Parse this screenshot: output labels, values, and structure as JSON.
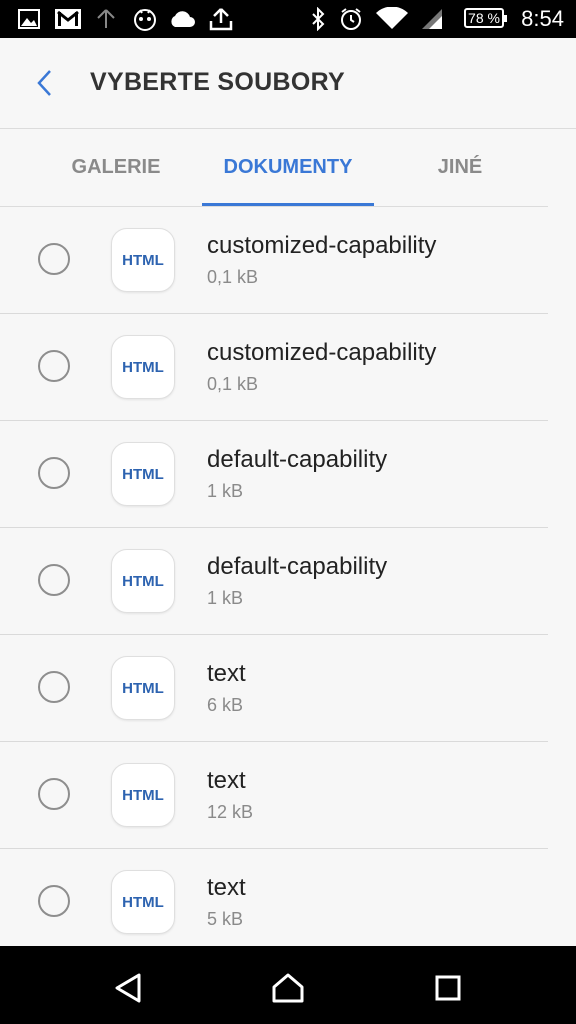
{
  "status_bar": {
    "time": "8:54",
    "battery": "78 %",
    "icons": [
      "gallery-icon",
      "gmail-icon",
      "upload-arrow-icon",
      "robot-icon",
      "cloud-icon",
      "share-upload-icon",
      "bluetooth-icon",
      "alarm-icon",
      "wifi-icon",
      "signal-icon",
      "battery-icon"
    ]
  },
  "header": {
    "title": "VYBERTE SOUBORY",
    "back_icon": "back-arrow-icon"
  },
  "tabs": [
    {
      "label": "GALERIE",
      "active": false
    },
    {
      "label": "DOKUMENTY",
      "active": true
    },
    {
      "label": "JINÉ",
      "active": false
    }
  ],
  "files": [
    {
      "name": "customized-capability",
      "size": "0,1 kB",
      "type": "HTML"
    },
    {
      "name": "customized-capability",
      "size": "0,1 kB",
      "type": "HTML"
    },
    {
      "name": "default-capability",
      "size": "1 kB",
      "type": "HTML"
    },
    {
      "name": "default-capability",
      "size": "1 kB",
      "type": "HTML"
    },
    {
      "name": "text",
      "size": "6 kB",
      "type": "HTML"
    },
    {
      "name": "text",
      "size": "12 kB",
      "type": "HTML"
    },
    {
      "name": "text",
      "size": "5 kB",
      "type": "HTML"
    }
  ],
  "colors": {
    "accent": "#3a78d6",
    "file_type_text": "#2d63b0"
  },
  "nav_bar": {
    "icons": [
      "back-triangle-icon",
      "home-icon",
      "recents-square-icon"
    ]
  }
}
